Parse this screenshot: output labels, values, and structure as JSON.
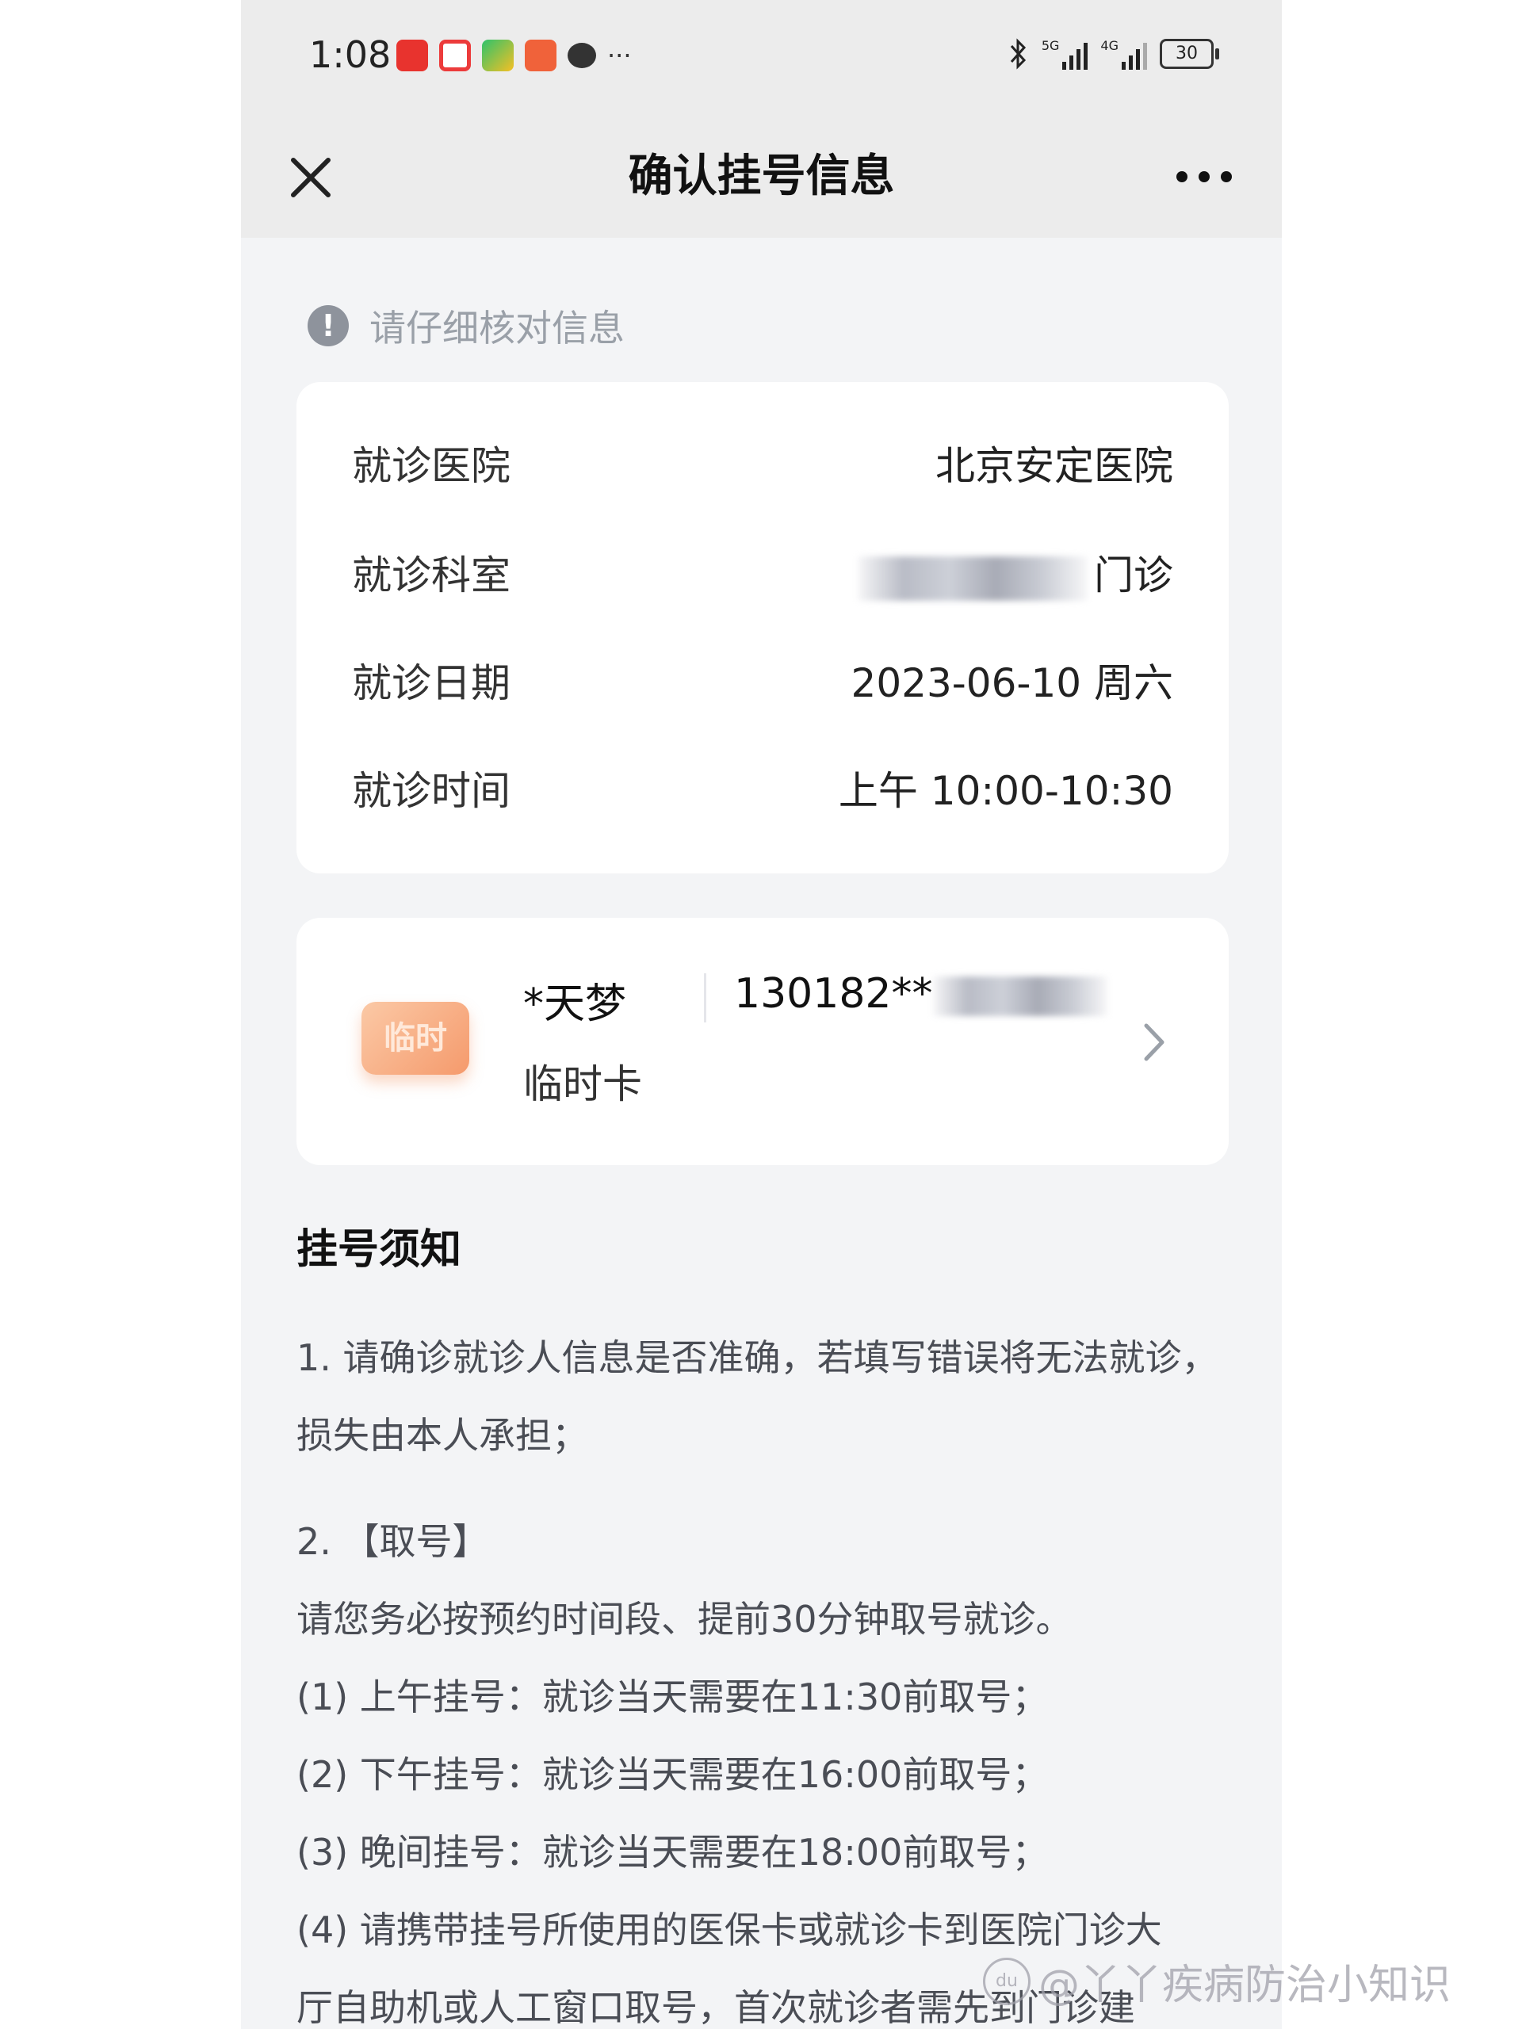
{
  "status_bar": {
    "time": "1:08",
    "battery": "30",
    "signal_5g": "5G",
    "signal_4g": "4G"
  },
  "nav": {
    "title": "确认挂号信息"
  },
  "tip": {
    "text": "请仔细核对信息"
  },
  "info": {
    "rows": [
      {
        "label": "就诊医院",
        "value": "北京安定医院"
      },
      {
        "label": "就诊科室",
        "value": "门诊"
      },
      {
        "label": "就诊日期",
        "value": "2023-06-10 周六"
      },
      {
        "label": "就诊时间",
        "value": "上午 10:00-10:30"
      }
    ]
  },
  "patient": {
    "badge": "临时",
    "name": "*天梦",
    "id_number": "130182**",
    "card_type": "临时卡"
  },
  "notice": {
    "title": "挂号须知",
    "item1": "1. 请确诊就诊人信息是否准确，若填写错误将无法就诊，损失由本人承担；",
    "item2_lines": [
      "2. 【取号】",
      "请您务必按预约时间段、提前30分钟取号就诊。",
      "(1) 上午挂号：就诊当天需要在11:30前取号；",
      "(2) 下午挂号：就诊当天需要在16:00前取号；",
      "(3) 晚间挂号：就诊当天需要在18:00前取号；",
      "(4) 请携带挂号所使用的医保卡或就诊卡到医院门诊大",
      "厅自助机或人工窗口取号，首次就诊者需先到门诊建"
    ]
  },
  "watermark": "@丫丫疾病防治小知识"
}
